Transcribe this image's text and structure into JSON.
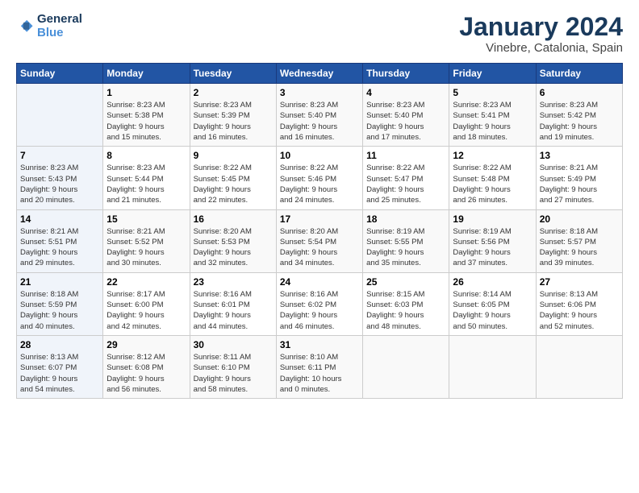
{
  "logo": {
    "line1": "General",
    "line2": "Blue"
  },
  "title": "January 2024",
  "subtitle": "Vinebre, Catalonia, Spain",
  "columns": [
    "Sunday",
    "Monday",
    "Tuesday",
    "Wednesday",
    "Thursday",
    "Friday",
    "Saturday"
  ],
  "weeks": [
    [
      {
        "day": "",
        "lines": []
      },
      {
        "day": "1",
        "lines": [
          "Sunrise: 8:23 AM",
          "Sunset: 5:38 PM",
          "Daylight: 9 hours",
          "and 15 minutes."
        ]
      },
      {
        "day": "2",
        "lines": [
          "Sunrise: 8:23 AM",
          "Sunset: 5:39 PM",
          "Daylight: 9 hours",
          "and 16 minutes."
        ]
      },
      {
        "day": "3",
        "lines": [
          "Sunrise: 8:23 AM",
          "Sunset: 5:40 PM",
          "Daylight: 9 hours",
          "and 16 minutes."
        ]
      },
      {
        "day": "4",
        "lines": [
          "Sunrise: 8:23 AM",
          "Sunset: 5:40 PM",
          "Daylight: 9 hours",
          "and 17 minutes."
        ]
      },
      {
        "day": "5",
        "lines": [
          "Sunrise: 8:23 AM",
          "Sunset: 5:41 PM",
          "Daylight: 9 hours",
          "and 18 minutes."
        ]
      },
      {
        "day": "6",
        "lines": [
          "Sunrise: 8:23 AM",
          "Sunset: 5:42 PM",
          "Daylight: 9 hours",
          "and 19 minutes."
        ]
      }
    ],
    [
      {
        "day": "7",
        "lines": [
          "Sunrise: 8:23 AM",
          "Sunset: 5:43 PM",
          "Daylight: 9 hours",
          "and 20 minutes."
        ]
      },
      {
        "day": "8",
        "lines": [
          "Sunrise: 8:23 AM",
          "Sunset: 5:44 PM",
          "Daylight: 9 hours",
          "and 21 minutes."
        ]
      },
      {
        "day": "9",
        "lines": [
          "Sunrise: 8:22 AM",
          "Sunset: 5:45 PM",
          "Daylight: 9 hours",
          "and 22 minutes."
        ]
      },
      {
        "day": "10",
        "lines": [
          "Sunrise: 8:22 AM",
          "Sunset: 5:46 PM",
          "Daylight: 9 hours",
          "and 24 minutes."
        ]
      },
      {
        "day": "11",
        "lines": [
          "Sunrise: 8:22 AM",
          "Sunset: 5:47 PM",
          "Daylight: 9 hours",
          "and 25 minutes."
        ]
      },
      {
        "day": "12",
        "lines": [
          "Sunrise: 8:22 AM",
          "Sunset: 5:48 PM",
          "Daylight: 9 hours",
          "and 26 minutes."
        ]
      },
      {
        "day": "13",
        "lines": [
          "Sunrise: 8:21 AM",
          "Sunset: 5:49 PM",
          "Daylight: 9 hours",
          "and 27 minutes."
        ]
      }
    ],
    [
      {
        "day": "14",
        "lines": [
          "Sunrise: 8:21 AM",
          "Sunset: 5:51 PM",
          "Daylight: 9 hours",
          "and 29 minutes."
        ]
      },
      {
        "day": "15",
        "lines": [
          "Sunrise: 8:21 AM",
          "Sunset: 5:52 PM",
          "Daylight: 9 hours",
          "and 30 minutes."
        ]
      },
      {
        "day": "16",
        "lines": [
          "Sunrise: 8:20 AM",
          "Sunset: 5:53 PM",
          "Daylight: 9 hours",
          "and 32 minutes."
        ]
      },
      {
        "day": "17",
        "lines": [
          "Sunrise: 8:20 AM",
          "Sunset: 5:54 PM",
          "Daylight: 9 hours",
          "and 34 minutes."
        ]
      },
      {
        "day": "18",
        "lines": [
          "Sunrise: 8:19 AM",
          "Sunset: 5:55 PM",
          "Daylight: 9 hours",
          "and 35 minutes."
        ]
      },
      {
        "day": "19",
        "lines": [
          "Sunrise: 8:19 AM",
          "Sunset: 5:56 PM",
          "Daylight: 9 hours",
          "and 37 minutes."
        ]
      },
      {
        "day": "20",
        "lines": [
          "Sunrise: 8:18 AM",
          "Sunset: 5:57 PM",
          "Daylight: 9 hours",
          "and 39 minutes."
        ]
      }
    ],
    [
      {
        "day": "21",
        "lines": [
          "Sunrise: 8:18 AM",
          "Sunset: 5:59 PM",
          "Daylight: 9 hours",
          "and 40 minutes."
        ]
      },
      {
        "day": "22",
        "lines": [
          "Sunrise: 8:17 AM",
          "Sunset: 6:00 PM",
          "Daylight: 9 hours",
          "and 42 minutes."
        ]
      },
      {
        "day": "23",
        "lines": [
          "Sunrise: 8:16 AM",
          "Sunset: 6:01 PM",
          "Daylight: 9 hours",
          "and 44 minutes."
        ]
      },
      {
        "day": "24",
        "lines": [
          "Sunrise: 8:16 AM",
          "Sunset: 6:02 PM",
          "Daylight: 9 hours",
          "and 46 minutes."
        ]
      },
      {
        "day": "25",
        "lines": [
          "Sunrise: 8:15 AM",
          "Sunset: 6:03 PM",
          "Daylight: 9 hours",
          "and 48 minutes."
        ]
      },
      {
        "day": "26",
        "lines": [
          "Sunrise: 8:14 AM",
          "Sunset: 6:05 PM",
          "Daylight: 9 hours",
          "and 50 minutes."
        ]
      },
      {
        "day": "27",
        "lines": [
          "Sunrise: 8:13 AM",
          "Sunset: 6:06 PM",
          "Daylight: 9 hours",
          "and 52 minutes."
        ]
      }
    ],
    [
      {
        "day": "28",
        "lines": [
          "Sunrise: 8:13 AM",
          "Sunset: 6:07 PM",
          "Daylight: 9 hours",
          "and 54 minutes."
        ]
      },
      {
        "day": "29",
        "lines": [
          "Sunrise: 8:12 AM",
          "Sunset: 6:08 PM",
          "Daylight: 9 hours",
          "and 56 minutes."
        ]
      },
      {
        "day": "30",
        "lines": [
          "Sunrise: 8:11 AM",
          "Sunset: 6:10 PM",
          "Daylight: 9 hours",
          "and 58 minutes."
        ]
      },
      {
        "day": "31",
        "lines": [
          "Sunrise: 8:10 AM",
          "Sunset: 6:11 PM",
          "Daylight: 10 hours",
          "and 0 minutes."
        ]
      },
      {
        "day": "",
        "lines": []
      },
      {
        "day": "",
        "lines": []
      },
      {
        "day": "",
        "lines": []
      }
    ]
  ]
}
